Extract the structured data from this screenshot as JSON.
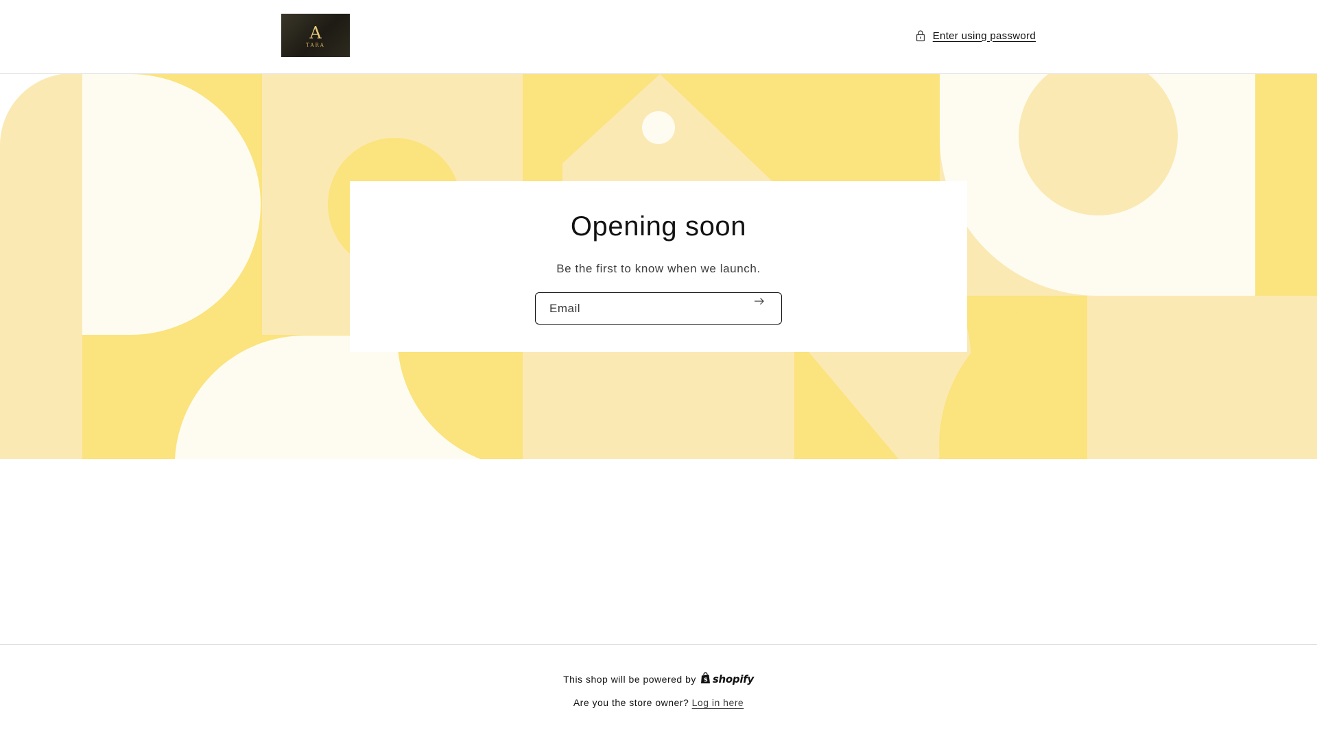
{
  "header": {
    "logo": {
      "alt": "TARA",
      "mark": "A",
      "text": "TARA"
    },
    "password_link": {
      "label": "Enter using password",
      "icon": "lock-icon"
    }
  },
  "banner": {
    "colors": {
      "light": "#fbe9b4",
      "mid": "#fbe37d",
      "cream": "#fefcf1"
    }
  },
  "card": {
    "title": "Opening soon",
    "subtitle": "Be the first to know when we launch.",
    "email_placeholder": "Email",
    "submit_icon": "arrow-right-icon"
  },
  "footer": {
    "powered_text": "This shop will be powered by",
    "brand": "shopify",
    "owner_text": "Are you the store owner?",
    "login_link": "Log in here"
  }
}
